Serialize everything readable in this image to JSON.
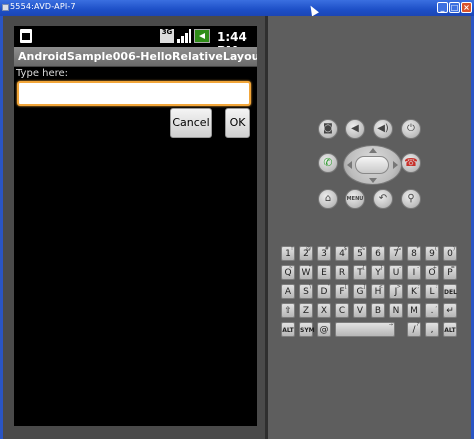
{
  "window": {
    "title": "5554:AVD-API-7",
    "min": "_",
    "max": "□",
    "close": "×"
  },
  "status": {
    "net": "3G",
    "time": "1:44 PM"
  },
  "app": {
    "title": "AndroidSample006-HelloRelativeLayout",
    "label": "Type here:",
    "entry_value": "",
    "cancel": "Cancel",
    "ok": "OK"
  },
  "controls": {
    "camera": "camera-icon",
    "volume_down": "volume-down-icon",
    "volume_up": "volume-up-icon",
    "power": "power-icon",
    "call": "call-icon",
    "end_call": "end-call-icon",
    "home": "home-icon",
    "menu": "MENU",
    "back": "back-icon",
    "search": "search-icon"
  },
  "keyboard": {
    "row1": [
      {
        "main": "1",
        "sub": "!"
      },
      {
        "main": "2",
        "sub": "@"
      },
      {
        "main": "3",
        "sub": "#"
      },
      {
        "main": "4",
        "sub": "$"
      },
      {
        "main": "5",
        "sub": "%"
      },
      {
        "main": "6",
        "sub": "^"
      },
      {
        "main": "7",
        "sub": "&"
      },
      {
        "main": "8",
        "sub": "*"
      },
      {
        "main": "9",
        "sub": "("
      },
      {
        "main": "0",
        "sub": ")"
      }
    ],
    "row2": [
      {
        "main": "Q",
        "sub": "~"
      },
      {
        "main": "W",
        "sub": "\""
      },
      {
        "main": "E",
        "sub": "´"
      },
      {
        "main": "R",
        "sub": ""
      },
      {
        "main": "T",
        "sub": "{"
      },
      {
        "main": "Y",
        "sub": "}"
      },
      {
        "main": "U",
        "sub": "-"
      },
      {
        "main": "I",
        "sub": "-"
      },
      {
        "main": "O",
        "sub": "+"
      },
      {
        "main": "P",
        "sub": "="
      }
    ],
    "row3": [
      {
        "main": "A",
        "sub": ""
      },
      {
        "main": "S",
        "sub": "\\"
      },
      {
        "main": "D",
        "sub": "'"
      },
      {
        "main": "F",
        "sub": "["
      },
      {
        "main": "G",
        "sub": "]"
      },
      {
        "main": "H",
        "sub": "<"
      },
      {
        "main": "J",
        "sub": ">"
      },
      {
        "main": "K",
        "sub": ";"
      },
      {
        "main": "L",
        "sub": ":"
      },
      {
        "main": "DEL",
        "sub": ""
      }
    ],
    "row4": [
      {
        "main": "⇧",
        "sub": ""
      },
      {
        "main": "Z",
        "sub": ""
      },
      {
        "main": "X",
        "sub": ""
      },
      {
        "main": "C",
        "sub": ""
      },
      {
        "main": "V",
        "sub": ""
      },
      {
        "main": "B",
        "sub": ""
      },
      {
        "main": "N",
        "sub": ""
      },
      {
        "main": "M",
        "sub": ""
      },
      {
        "main": ".",
        "sub": ","
      },
      {
        "main": "↵",
        "sub": ""
      }
    ],
    "row5": {
      "alt_left": "ALT",
      "sym": "SYM",
      "at": "@",
      "space": "",
      "arrow": "→",
      "slash": "/",
      "qmark": "?",
      "comma": ",",
      "alt_right": "ALT"
    }
  }
}
